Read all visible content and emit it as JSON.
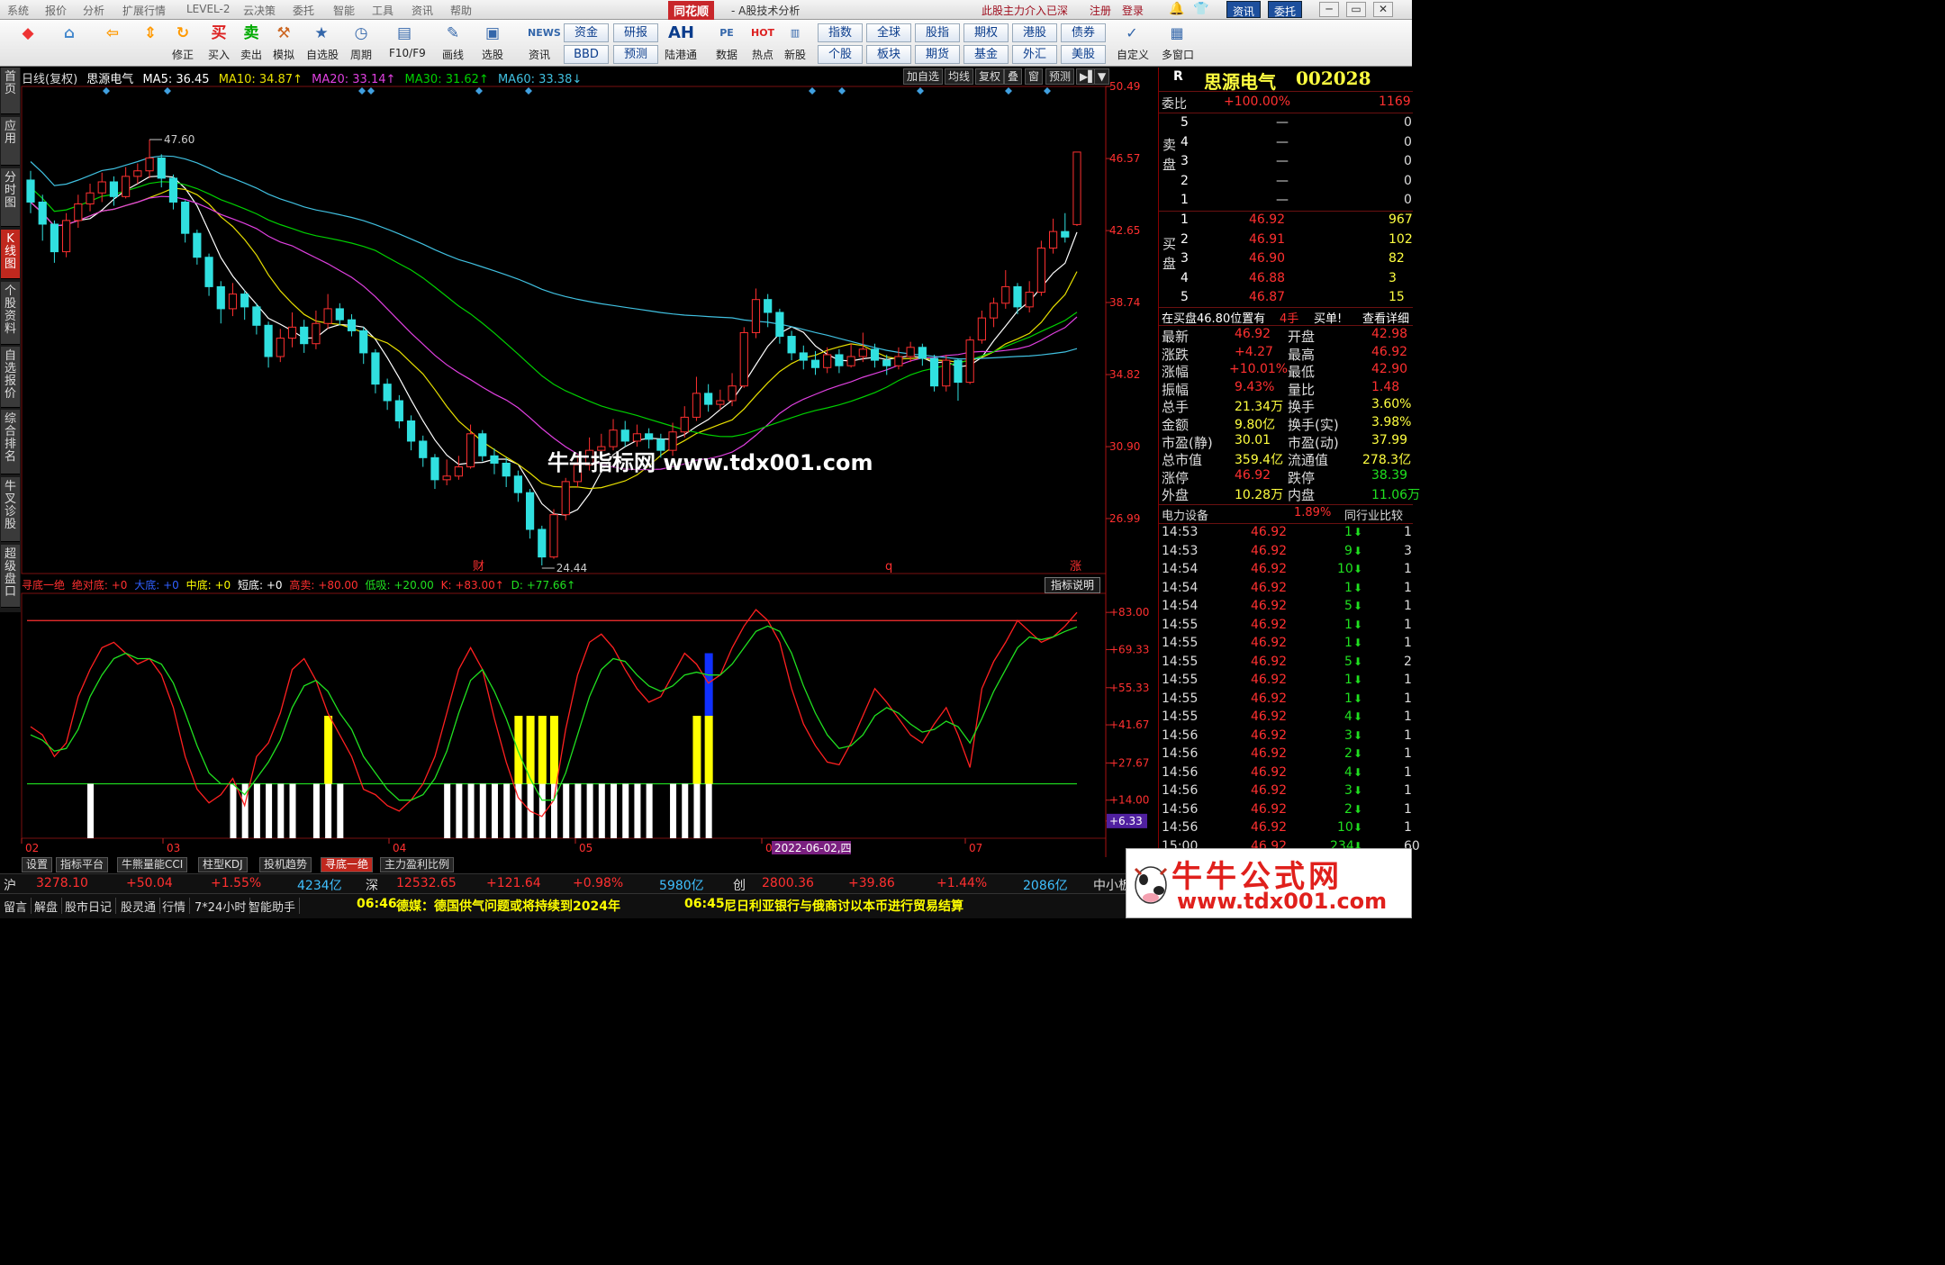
{
  "menu": {
    "items": [
      "系统",
      "报价",
      "分析",
      "扩展行情",
      "LEVEL-2",
      "云决策",
      "委托",
      "智能",
      "工具",
      "资讯",
      "帮助"
    ],
    "brand": "同花顺",
    "title": "- A股技术分析",
    "right_links": [
      "此股主力介入已深",
      "注册",
      "登录"
    ],
    "btn_news": "资讯",
    "btn_trade": "委托",
    "winctl": [
      "─",
      "▭",
      "✕"
    ]
  },
  "toolbar": {
    "buttons": [
      {
        "icon": "◆",
        "label": ""
      },
      {
        "icon": "⌂",
        "label": ""
      },
      {
        "icon": "⇦",
        "label": ""
      },
      {
        "icon": "⇕",
        "label": ""
      },
      {
        "icon": "↻",
        "label": "修正"
      },
      {
        "icon": "买",
        "label": "买入"
      },
      {
        "icon": "卖",
        "label": "卖出"
      },
      {
        "icon": "⚒",
        "label": "模拟"
      },
      {
        "icon": "★",
        "label": "自选股"
      },
      {
        "icon": "◷",
        "label": "周期"
      },
      {
        "icon": "▤",
        "label": "F10/F9"
      },
      {
        "icon": "✎",
        "label": "画线"
      },
      {
        "icon": "▣",
        "label": "选股"
      },
      {
        "icon": "NEWS",
        "label": "资讯"
      }
    ],
    "txt1": [
      "资金",
      "研报",
      "BBD",
      "预测"
    ],
    "ah": {
      "icon": "AH",
      "label": "陆港通"
    },
    "pe": {
      "icon": "PE",
      "label": "数据"
    },
    "hot": {
      "icon": "HOT",
      "label": "热点"
    },
    "newstock": {
      "icon": "▥",
      "label": "新股"
    },
    "txt2": [
      "指数",
      "全球",
      "股指",
      "期权",
      "港股",
      "债券",
      "个股",
      "板块",
      "期货",
      "基金",
      "外汇",
      "美股"
    ],
    "custom": {
      "icon": "✓",
      "label": "自定义"
    },
    "multi": {
      "icon": "▦",
      "label": "多窗口"
    }
  },
  "vtabs": [
    "首页",
    "应用",
    "分时图",
    "K线图",
    "个股资料",
    "自选报价",
    "综合排名",
    "牛叉诊股",
    "超级盘口"
  ],
  "chart_header": {
    "period": "日线(复权)",
    "name": "思源电气",
    "ma5": "MA5: 36.45",
    "ma10": "MA10: 34.87↑",
    "ma20": "MA20: 33.14↑",
    "ma30": "MA30: 31.62↑",
    "ma60": "MA60: 33.38↓"
  },
  "chart_tabs": [
    "加自选",
    "均线",
    "复权",
    "叠",
    "窗",
    "预测",
    "▶▌",
    "▼"
  ],
  "price_axis": [
    "50.49",
    "46.57",
    "42.65",
    "38.74",
    "34.82",
    "30.90",
    "26.99"
  ],
  "indicator_axis": [
    "+83.00",
    "+69.33",
    "+55.33",
    "+41.67",
    "+27.67",
    "+14.00",
    "+6.33"
  ],
  "date_axis": [
    "02",
    "03",
    "04",
    "05",
    "06",
    "07"
  ],
  "date_highlight": "2022-06-02,四",
  "annotations": {
    "high": "47.60",
    "low": "24.44",
    "marker1": "财",
    "marker2": "q",
    "marker3": "涨"
  },
  "indicator_header": {
    "name": "寻底一绝",
    "a": "绝对底: +0",
    "b": "大底: +0",
    "c": "中底: +0",
    "d": "短底: +0",
    "e": "高卖: +80.00",
    "f": "低吸: +20.00",
    "k": "K: +83.00↑",
    "dv": "D: +77.66↑",
    "explain": "指标说明"
  },
  "bottom_tabs": [
    "设置",
    "指标平台",
    "牛熊量能CCI",
    "柱型KDJ",
    "投机趋势",
    "寻底一绝",
    "主力盈利比例"
  ],
  "ticker": {
    "sh_label": "沪",
    "sh_val": "3278.10",
    "sh_chg": "+50.04",
    "sh_pct": "+1.55%",
    "sh_amt": "4234亿",
    "sz_label": "深",
    "sz_val": "12532.65",
    "sz_chg": "+121.64",
    "sz_pct": "+0.98%",
    "sz_amt": "5980亿",
    "cy_label": "创",
    "cy_val": "2800.36",
    "cy_chg": "+39.86",
    "cy_pct": "+1.44%",
    "cy_amt": "2086亿",
    "more": "中小板"
  },
  "newsbar": {
    "tabs": [
      "留言",
      "解盘",
      "股市日记",
      "股灵通",
      "行情",
      "7*24小时",
      "智能助手"
    ],
    "news1_time": "06:46",
    "news1": "德媒：德国供气问题或将持续到2024年",
    "news2_time": "06:45",
    "news2": "尼日利亚银行与俄商讨以本币进行贸易结算"
  },
  "quote": {
    "flag": "R",
    "name": "思源电气",
    "code": "002028",
    "weibi_label": "委比",
    "weibi": "+100.00%",
    "weicha": "1169",
    "sell_label": "卖盘",
    "buy_label": "买盘",
    "sell": [
      {
        "n": "5",
        "p": "—",
        "v": "0"
      },
      {
        "n": "4",
        "p": "—",
        "v": "0"
      },
      {
        "n": "3",
        "p": "—",
        "v": "0"
      },
      {
        "n": "2",
        "p": "—",
        "v": "0"
      },
      {
        "n": "1",
        "p": "—",
        "v": "0"
      }
    ],
    "buy": [
      {
        "n": "1",
        "p": "46.92",
        "v": "967"
      },
      {
        "n": "2",
        "p": "46.91",
        "v": "102"
      },
      {
        "n": "3",
        "p": "46.90",
        "v": "82"
      },
      {
        "n": "4",
        "p": "46.88",
        "v": "3"
      },
      {
        "n": "5",
        "p": "46.87",
        "v": "15"
      }
    ],
    "notice": "在买盘46.80位置有",
    "notice_q": "4手",
    "notice_type": "买单!",
    "notice_link": "查看详细",
    "stats": [
      {
        "l1": "最新",
        "v1": "46.92",
        "l2": "开盘",
        "v2": "42.98"
      },
      {
        "l1": "涨跌",
        "v1": "+4.27",
        "l2": "最高",
        "v2": "46.92"
      },
      {
        "l1": "涨幅",
        "v1": "+10.01%",
        "l2": "最低",
        "v2": "42.90"
      },
      {
        "l1": "振幅",
        "v1": "9.43%",
        "l2": "量比",
        "v2": "1.48"
      },
      {
        "l1": "总手",
        "v1": "21.34万",
        "l2": "换手",
        "v2": "3.60%"
      },
      {
        "l1": "金额",
        "v1": "9.80亿",
        "l2": "换手(实)",
        "v2": "3.98%"
      },
      {
        "l1": "市盈(静)",
        "v1": "30.01",
        "l2": "市盈(动)",
        "v2": "37.99"
      },
      {
        "l1": "总市值",
        "v1": "359.4亿",
        "l2": "流通值",
        "v2": "278.3亿"
      },
      {
        "l1": "涨停",
        "v1": "46.92",
        "l2": "跌停",
        "v2": "38.39"
      },
      {
        "l1": "外盘",
        "v1": "10.28万",
        "l2": "内盘",
        "v2": "11.06万"
      }
    ],
    "industry": "电力设备",
    "industry_pct": "1.89%",
    "industry_link": "同行业比较",
    "ticks": [
      {
        "t": "14:53",
        "p": "46.92",
        "v": "1",
        "x": "1"
      },
      {
        "t": "14:53",
        "p": "46.92",
        "v": "9",
        "x": "3"
      },
      {
        "t": "14:54",
        "p": "46.92",
        "v": "10",
        "x": "1"
      },
      {
        "t": "14:54",
        "p": "46.92",
        "v": "1",
        "x": "1"
      },
      {
        "t": "14:54",
        "p": "46.92",
        "v": "5",
        "x": "1"
      },
      {
        "t": "14:55",
        "p": "46.92",
        "v": "1",
        "x": "1"
      },
      {
        "t": "14:55",
        "p": "46.92",
        "v": "1",
        "x": "1"
      },
      {
        "t": "14:55",
        "p": "46.92",
        "v": "5",
        "x": "2"
      },
      {
        "t": "14:55",
        "p": "46.92",
        "v": "1",
        "x": "1"
      },
      {
        "t": "14:55",
        "p": "46.92",
        "v": "1",
        "x": "1"
      },
      {
        "t": "14:55",
        "p": "46.92",
        "v": "4",
        "x": "1"
      },
      {
        "t": "14:56",
        "p": "46.92",
        "v": "3",
        "x": "1"
      },
      {
        "t": "14:56",
        "p": "46.92",
        "v": "2",
        "x": "1"
      },
      {
        "t": "14:56",
        "p": "46.92",
        "v": "4",
        "x": "1"
      },
      {
        "t": "14:56",
        "p": "46.92",
        "v": "3",
        "x": "1"
      },
      {
        "t": "14:56",
        "p": "46.92",
        "v": "2",
        "x": "1"
      },
      {
        "t": "14:56",
        "p": "46.92",
        "v": "10",
        "x": "1"
      },
      {
        "t": "15:00",
        "p": "46.92",
        "v": "234",
        "x": "60"
      }
    ]
  },
  "watermark": "牛牛指标网 www.tdx001.com",
  "brand_logo": {
    "title": "牛牛公式网",
    "url": "www.tdx001.com"
  },
  "colors": {
    "up": "#ff3030",
    "down": "#30e0e0",
    "ma5": "#ffffff",
    "ma10": "#e8e000",
    "ma20": "#e040e0",
    "ma30": "#00d000",
    "ma60": "#40c0e0",
    "k": "#ff2020",
    "d": "#20e020"
  },
  "chart_data": {
    "type": "candlestick",
    "price_range": [
      24.0,
      50.49
    ],
    "candles": [
      [
        45.4,
        44.2,
        45.9,
        43.6
      ],
      [
        44.2,
        43.0,
        44.6,
        42.1
      ],
      [
        43.0,
        41.5,
        43.2,
        40.9
      ],
      [
        41.5,
        43.2,
        43.6,
        41.2
      ],
      [
        43.2,
        44.1,
        44.6,
        42.8
      ],
      [
        44.1,
        44.7,
        45.2,
        43.7
      ],
      [
        44.7,
        45.3,
        45.8,
        44.2
      ],
      [
        45.3,
        44.5,
        45.6,
        44.0
      ],
      [
        44.5,
        45.6,
        46.1,
        44.4
      ],
      [
        45.6,
        45.9,
        46.3,
        45.2
      ],
      [
        45.9,
        46.6,
        47.6,
        45.5
      ],
      [
        46.6,
        45.5,
        46.8,
        45.0
      ],
      [
        45.5,
        44.2,
        45.7,
        43.8
      ],
      [
        44.2,
        42.5,
        44.3,
        42.0
      ],
      [
        42.5,
        41.2,
        42.7,
        40.8
      ],
      [
        41.2,
        39.6,
        41.4,
        39.1
      ],
      [
        39.6,
        38.4,
        39.9,
        37.6
      ],
      [
        38.4,
        39.2,
        39.8,
        38.0
      ],
      [
        39.2,
        38.5,
        39.4,
        37.8
      ],
      [
        38.5,
        37.5,
        38.7,
        37.0
      ],
      [
        37.5,
        35.8,
        37.7,
        35.2
      ],
      [
        35.8,
        36.8,
        37.3,
        35.5
      ],
      [
        36.8,
        37.4,
        38.2,
        36.3
      ],
      [
        37.4,
        36.5,
        37.8,
        36.0
      ],
      [
        36.5,
        37.6,
        38.3,
        36.2
      ],
      [
        37.6,
        38.4,
        39.2,
        37.3
      ],
      [
        38.4,
        37.8,
        38.7,
        37.5
      ],
      [
        37.8,
        37.2,
        38.1,
        36.9
      ],
      [
        37.2,
        36.0,
        37.4,
        35.4
      ],
      [
        36.0,
        34.3,
        36.2,
        33.8
      ],
      [
        34.3,
        33.4,
        34.6,
        32.9
      ],
      [
        33.4,
        32.3,
        33.7,
        31.9
      ],
      [
        32.3,
        31.2,
        32.6,
        30.7
      ],
      [
        31.2,
        30.3,
        31.5,
        29.8
      ],
      [
        30.3,
        29.1,
        30.5,
        28.6
      ],
      [
        29.1,
        29.3,
        30.2,
        28.8
      ],
      [
        29.3,
        29.8,
        30.4,
        29.1
      ],
      [
        29.8,
        31.6,
        32.1,
        29.7
      ],
      [
        31.6,
        30.4,
        31.8,
        30.1
      ],
      [
        30.4,
        30.0,
        30.8,
        29.4
      ],
      [
        30.0,
        29.3,
        30.3,
        28.7
      ],
      [
        29.3,
        28.4,
        29.6,
        27.9
      ],
      [
        28.4,
        26.4,
        28.6,
        25.9
      ],
      [
        26.4,
        24.9,
        26.6,
        24.44
      ],
      [
        24.9,
        27.2,
        27.5,
        24.8
      ],
      [
        27.2,
        29.0,
        29.2,
        26.9
      ],
      [
        29.0,
        29.9,
        30.5,
        28.7
      ],
      [
        29.9,
        30.7,
        31.4,
        29.6
      ],
      [
        30.7,
        30.9,
        31.6,
        30.2
      ],
      [
        30.9,
        31.8,
        32.4,
        30.7
      ],
      [
        31.8,
        31.2,
        32.3,
        30.9
      ],
      [
        31.2,
        31.6,
        32.1,
        30.9
      ],
      [
        31.6,
        31.3,
        31.9,
        30.8
      ],
      [
        31.3,
        30.7,
        31.6,
        30.3
      ],
      [
        30.7,
        31.7,
        32.2,
        30.4
      ],
      [
        31.7,
        32.5,
        33.1,
        31.4
      ],
      [
        32.5,
        33.8,
        34.7,
        32.3
      ],
      [
        33.8,
        33.2,
        34.3,
        32.8
      ],
      [
        33.2,
        33.4,
        34.0,
        32.9
      ],
      [
        33.4,
        34.2,
        34.9,
        33.1
      ],
      [
        34.2,
        37.1,
        37.4,
        34.1
      ],
      [
        37.1,
        38.9,
        39.5,
        36.8
      ],
      [
        38.9,
        38.2,
        39.2,
        37.4
      ],
      [
        38.2,
        36.9,
        38.4,
        36.5
      ],
      [
        36.9,
        36.0,
        37.2,
        35.6
      ],
      [
        36.0,
        35.6,
        36.4,
        35.1
      ],
      [
        35.6,
        35.2,
        36.1,
        34.8
      ],
      [
        35.2,
        35.9,
        36.3,
        34.9
      ],
      [
        35.9,
        35.3,
        36.2,
        34.9
      ],
      [
        35.3,
        35.8,
        36.5,
        35.2
      ],
      [
        35.8,
        36.2,
        37.1,
        35.5
      ],
      [
        36.2,
        35.6,
        36.5,
        35.2
      ],
      [
        35.6,
        35.3,
        35.9,
        34.8
      ],
      [
        35.3,
        35.8,
        36.3,
        35.1
      ],
      [
        35.8,
        36.3,
        36.6,
        35.5
      ],
      [
        36.3,
        35.7,
        36.5,
        35.3
      ],
      [
        35.7,
        34.2,
        35.9,
        33.9
      ],
      [
        34.2,
        35.6,
        35.9,
        33.9
      ],
      [
        35.6,
        34.4,
        35.7,
        33.4
      ],
      [
        34.4,
        36.7,
        36.9,
        34.3
      ],
      [
        36.7,
        37.9,
        38.3,
        36.5
      ],
      [
        37.9,
        38.7,
        39.0,
        37.4
      ],
      [
        38.7,
        39.6,
        40.5,
        38.4
      ],
      [
        39.6,
        38.5,
        39.8,
        38.1
      ],
      [
        38.5,
        39.3,
        39.9,
        38.2
      ],
      [
        39.3,
        41.7,
        42.1,
        39.1
      ],
      [
        41.7,
        42.6,
        43.3,
        41.4
      ],
      [
        42.6,
        42.3,
        43.6,
        42.0
      ],
      [
        42.98,
        46.92,
        46.92,
        42.9
      ]
    ],
    "kd_range": [
      0,
      90
    ],
    "k": [
      41,
      38,
      30,
      35,
      52,
      62,
      70,
      72,
      68,
      64,
      66,
      60,
      48,
      30,
      18,
      13,
      16,
      22,
      12,
      30,
      35,
      46,
      62,
      66,
      58,
      46,
      38,
      30,
      18,
      16,
      12,
      10,
      14,
      20,
      30,
      46,
      62,
      70,
      62,
      44,
      28,
      15,
      10,
      8,
      14,
      40,
      60,
      72,
      75,
      70,
      62,
      55,
      50,
      52,
      60,
      68,
      64,
      57,
      60,
      70,
      78,
      84,
      80,
      72,
      55,
      42,
      34,
      28,
      27,
      35,
      45,
      55,
      50,
      44,
      38,
      35,
      42,
      48,
      38,
      26,
      55,
      65,
      72,
      80,
      76,
      72,
      74,
      78,
      83
    ],
    "d": [
      38,
      36,
      32,
      33,
      40,
      52,
      60,
      66,
      68,
      66,
      66,
      64,
      57,
      46,
      34,
      24,
      20,
      20,
      16,
      22,
      28,
      36,
      48,
      56,
      58,
      54,
      46,
      40,
      30,
      24,
      18,
      14,
      14,
      16,
      22,
      32,
      46,
      58,
      62,
      54,
      44,
      32,
      22,
      14,
      14,
      24,
      38,
      52,
      62,
      66,
      65,
      60,
      56,
      54,
      56,
      60,
      61,
      60,
      60,
      64,
      70,
      76,
      78,
      76,
      68,
      56,
      46,
      38,
      33,
      34,
      38,
      45,
      48,
      46,
      42,
      39,
      40,
      43,
      41,
      35,
      44,
      54,
      62,
      70,
      74,
      73,
      74,
      76,
      77.66
    ],
    "bottom_bars_white": [
      5,
      17,
      18,
      19,
      20,
      21,
      22,
      24,
      25,
      26,
      35,
      36,
      37,
      38,
      39,
      40,
      41,
      42,
      43,
      44,
      45,
      46,
      47,
      48,
      49,
      50,
      51,
      52,
      54,
      55,
      56,
      57
    ],
    "bottom_bars_yellow": [
      25,
      41,
      42,
      43,
      44,
      56,
      57
    ],
    "bottom_bars_blue": [
      57
    ]
  }
}
